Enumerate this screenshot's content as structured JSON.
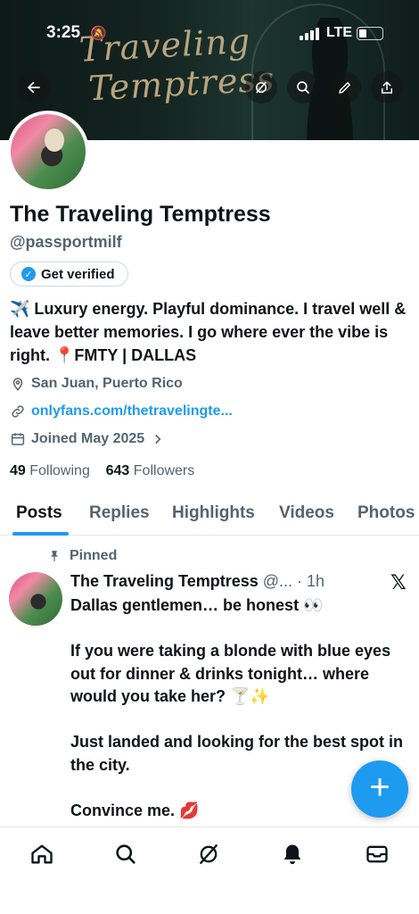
{
  "status_bar": {
    "time": "3:25",
    "network": "LTE"
  },
  "banner": {
    "logo_line1": "Traveling",
    "logo_line2": "Temptress"
  },
  "profile": {
    "name": "The Traveling Temptress",
    "handle": "@passportmilf",
    "verify_label": "Get verified",
    "bio": "✈️ Luxury energy. Playful dominance. I travel well & leave better memories. I go where ever the vibe is right. 📍FMTY | DALLAS",
    "location": "San Juan, Puerto Rico",
    "link": "onlyfans.com/thetravelingte...",
    "joined": "Joined May 2025",
    "following_count": "49",
    "following_label": "Following",
    "followers_count": "643",
    "followers_label": "Followers"
  },
  "tabs": [
    {
      "label": "Posts"
    },
    {
      "label": "Replies"
    },
    {
      "label": "Highlights"
    },
    {
      "label": "Videos"
    },
    {
      "label": "Photos"
    }
  ],
  "post": {
    "pinned_label": "Pinned",
    "author": "The Traveling Temptress",
    "meta": " @... · 1h",
    "text": "Dallas gentlemen… be honest 👀\n\nIf you were taking a blonde with blue eyes out for dinner & drinks tonight… where would you take her? 🍸✨\n\nJust landed and looking for the best spot in the city.\n\nConvince me. 💋"
  },
  "fab_label": "+",
  "colors": {
    "accent": "#1d9bf0",
    "text": "#0f1419",
    "muted": "#536471"
  }
}
